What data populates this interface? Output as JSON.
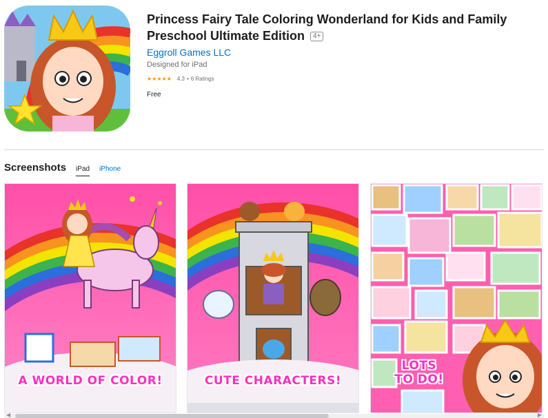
{
  "app": {
    "title": "Princess Fairy Tale Coloring Wonderland for Kids and Family Preschool Ultimate Edition",
    "age_rating": "4+",
    "developer": "Eggroll Games LLC",
    "designed_for": "Designed for iPad",
    "stars": "★★★★★",
    "rating_value": "4.3",
    "rating_separator": "•",
    "rating_count": "6 Ratings",
    "price": "Free"
  },
  "screenshots": {
    "title": "Screenshots",
    "tabs": [
      {
        "label": "iPad",
        "active": true
      },
      {
        "label": "iPhone",
        "active": false
      }
    ],
    "items": [
      {
        "caption": "A WORLD OF COLOR!"
      },
      {
        "caption": "CUTE CHARACTERS!"
      },
      {
        "caption_line1": "LOTS",
        "caption_line2": "TO DO!"
      }
    ]
  },
  "colors": {
    "accent": "#0070c9",
    "caption_pink": "#ff2fbf",
    "star_orange": "#ff9500"
  }
}
